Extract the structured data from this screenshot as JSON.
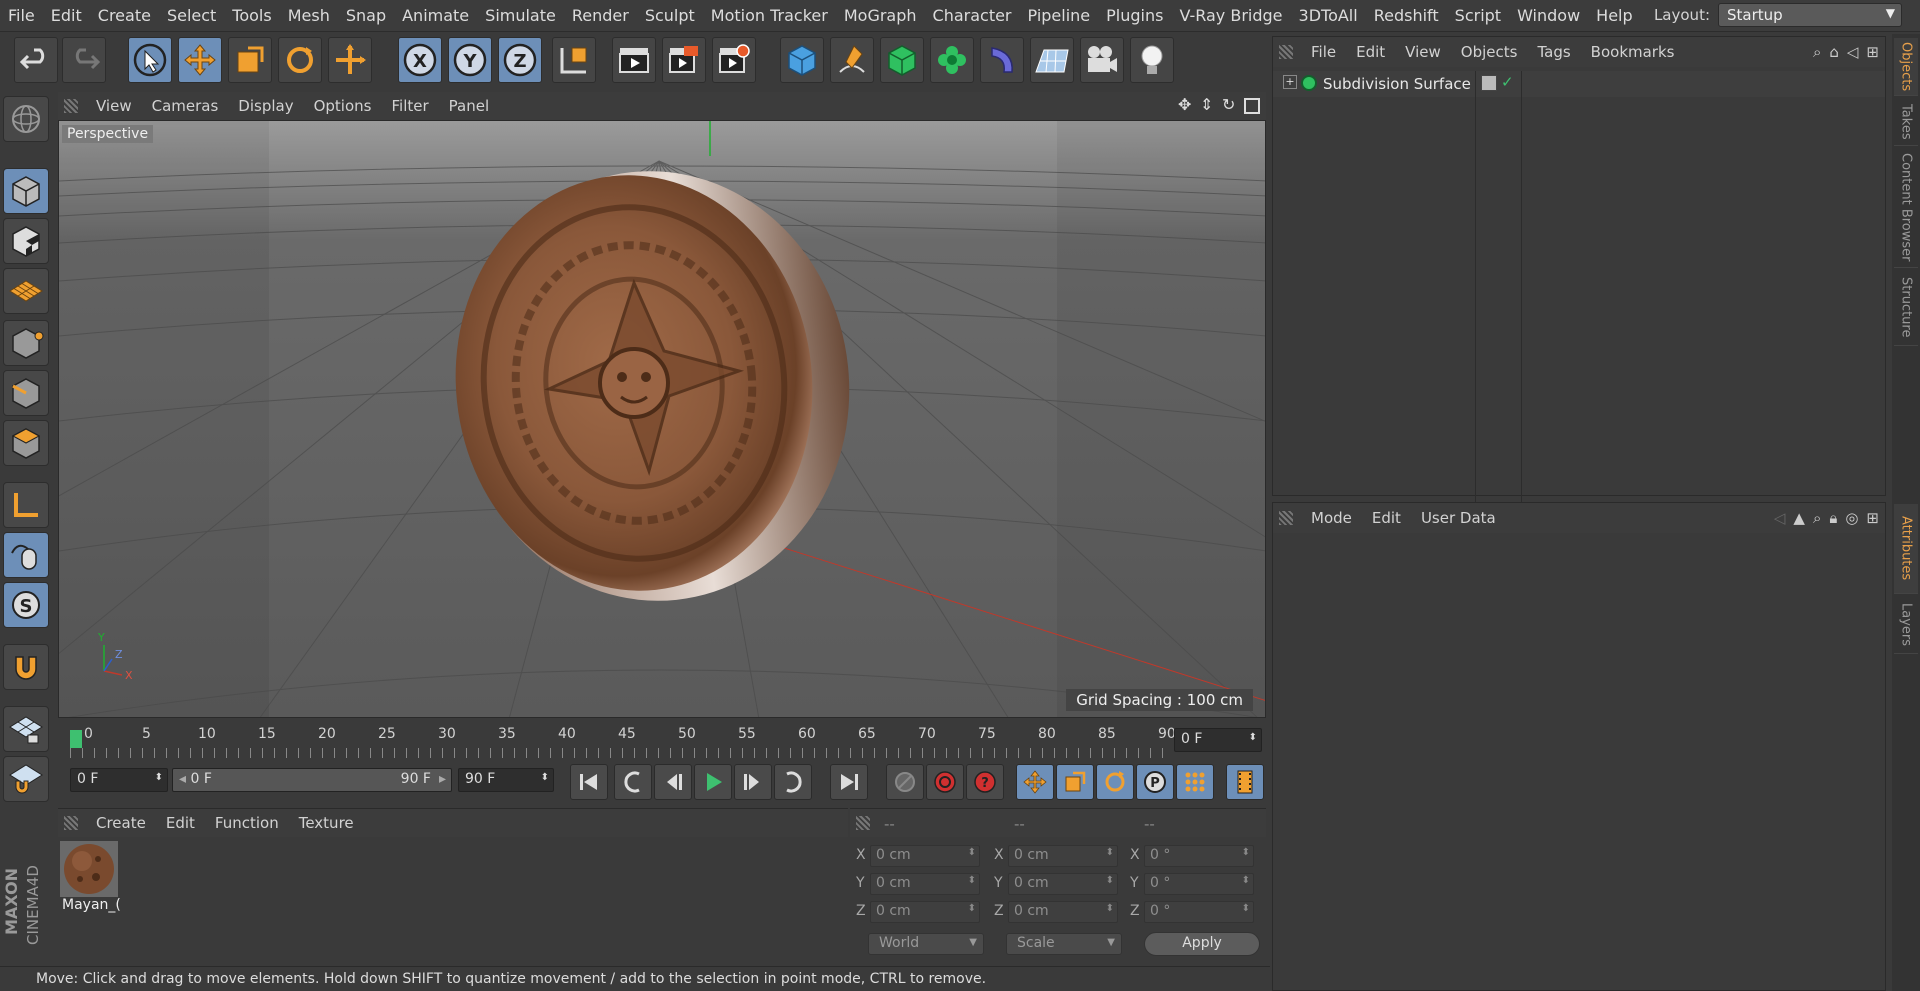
{
  "menubar": {
    "items": [
      "File",
      "Edit",
      "Create",
      "Select",
      "Tools",
      "Mesh",
      "Snap",
      "Animate",
      "Simulate",
      "Render",
      "Sculpt",
      "Motion Tracker",
      "MoGraph",
      "Character",
      "Pipeline",
      "Plugins",
      "V-Ray Bridge",
      "3DToAll",
      "Redshift",
      "Script",
      "Window",
      "Help"
    ],
    "layout_label": "Layout:",
    "layout_value": "Startup"
  },
  "viewport": {
    "menu": [
      "View",
      "Cameras",
      "Display",
      "Options",
      "Filter",
      "Panel"
    ],
    "label": "Perspective",
    "grid_spacing": "Grid Spacing : 100 cm",
    "axes": {
      "y": "Y",
      "z": "Z",
      "x": "X"
    }
  },
  "timeline": {
    "ticks": [
      "0",
      "5",
      "10",
      "15",
      "20",
      "25",
      "30",
      "35",
      "40",
      "45",
      "50",
      "55",
      "60",
      "65",
      "70",
      "75",
      "80",
      "85",
      "90"
    ],
    "current_frame": "0 F"
  },
  "transport": {
    "start_frame": "0 F",
    "range_start": "0 F",
    "range_end": "90 F",
    "end_frame": "90 F"
  },
  "materials": {
    "menu": [
      "Create",
      "Edit",
      "Function",
      "Texture"
    ],
    "items": [
      {
        "name": "Mayan_("
      }
    ]
  },
  "coords": {
    "headers": [
      "--",
      "--",
      "--"
    ],
    "pos": {
      "x": "0 cm",
      "y": "0 cm",
      "z": "0 cm"
    },
    "size": {
      "x": "0 cm",
      "y": "0 cm",
      "z": "0 cm"
    },
    "rot": {
      "x": "0 °",
      "y": "0 °",
      "z": "0 °"
    },
    "labels": {
      "x": "X",
      "y": "Y",
      "z": "Z"
    },
    "mode1": "World",
    "mode2": "Scale",
    "apply": "Apply"
  },
  "objects": {
    "menu": [
      "File",
      "Edit",
      "View",
      "Objects",
      "Tags",
      "Bookmarks"
    ],
    "items": [
      {
        "name": "Subdivision Surface"
      }
    ]
  },
  "attributes": {
    "menu": [
      "Mode",
      "Edit",
      "User Data"
    ]
  },
  "sidetabs": {
    "top": [
      "Objects",
      "Takes",
      "Content Browser",
      "Structure"
    ],
    "bottom": [
      "Attributes",
      "Layers"
    ]
  },
  "status": "Move: Click and drag to move elements. Hold down SHIFT to quantize movement / add to the selection in point mode, CTRL to remove.",
  "brand": {
    "line1": "MAXON",
    "line2": "CINEMA4D"
  },
  "colors": {
    "accent_blue": "#6d8fb8",
    "accent_orange": "#f0a030",
    "panel": "#3a3a3a",
    "viewport": "#5e5e5e"
  }
}
